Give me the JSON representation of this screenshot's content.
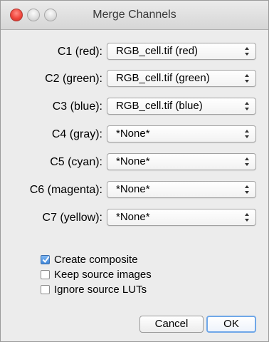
{
  "window": {
    "title": "Merge Channels"
  },
  "channels": [
    {
      "label": "C1 (red):",
      "value": "RGB_cell.tif (red)"
    },
    {
      "label": "C2 (green):",
      "value": "RGB_cell.tif (green)"
    },
    {
      "label": "C3 (blue):",
      "value": "RGB_cell.tif (blue)"
    },
    {
      "label": "C4 (gray):",
      "value": "*None*"
    },
    {
      "label": "C5 (cyan):",
      "value": "*None*"
    },
    {
      "label": "C6 (magenta):",
      "value": "*None*"
    },
    {
      "label": "C7 (yellow):",
      "value": "*None*"
    }
  ],
  "options": [
    {
      "label": "Create composite",
      "checked": true
    },
    {
      "label": "Keep source images",
      "checked": false
    },
    {
      "label": "Ignore source LUTs",
      "checked": false
    }
  ],
  "buttons": {
    "cancel": "Cancel",
    "ok": "OK"
  },
  "colors": {
    "accent": "#3f86d8",
    "close": "#f0463c"
  },
  "icons": {
    "close": "close-circle-icon",
    "minimize": "minimize-circle-icon",
    "maximize": "maximize-circle-icon",
    "dropdown": "updown-arrows-icon",
    "check": "checkmark-icon"
  }
}
